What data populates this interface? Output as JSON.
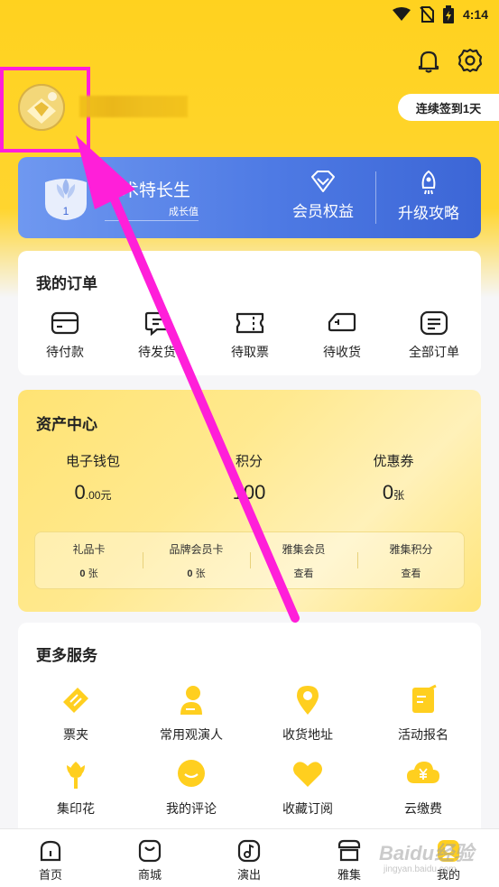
{
  "status_bar": {
    "time": "4:14",
    "icons": [
      "wifi-icon",
      "no-sim-icon",
      "battery-charging-icon"
    ]
  },
  "header": {
    "icons": [
      "bell-icon",
      "gear-icon"
    ],
    "signin_label": "连续签到1天"
  },
  "member": {
    "level_number": "1",
    "title": "艺术特长生",
    "growth_label": "成长值",
    "actions": [
      {
        "label": "会员权益",
        "icon": "diamond-icon"
      },
      {
        "label": "升级攻略",
        "icon": "rocket-icon"
      }
    ]
  },
  "orders": {
    "title": "我的订单",
    "items": [
      {
        "label": "待付款",
        "icon": "wallet-icon"
      },
      {
        "label": "待发货",
        "icon": "package-icon"
      },
      {
        "label": "待取票",
        "icon": "ticket-icon"
      },
      {
        "label": "待收货",
        "icon": "truck-icon"
      },
      {
        "label": "全部订单",
        "icon": "list-icon"
      }
    ]
  },
  "assets": {
    "title": "资产中心",
    "columns": [
      {
        "label": "电子钱包",
        "value": "0",
        "suffix": ".00元"
      },
      {
        "label": "积分",
        "value": "100",
        "suffix": ""
      },
      {
        "label": "优惠券",
        "value": "0",
        "suffix": "张"
      }
    ],
    "sub_items": [
      {
        "label": "礼品卡",
        "value": "0",
        "suffix": " 张"
      },
      {
        "label": "品牌会员卡",
        "value": "0",
        "suffix": " 张"
      },
      {
        "label": "雅集会员",
        "value": "",
        "suffix": "查看"
      },
      {
        "label": "雅集积分",
        "value": "",
        "suffix": "查看"
      }
    ]
  },
  "services": {
    "title": "更多服务",
    "items": [
      {
        "label": "票夹",
        "icon": "ticket-folder-icon"
      },
      {
        "label": "常用观演人",
        "icon": "person-icon"
      },
      {
        "label": "收货地址",
        "icon": "location-pin-icon"
      },
      {
        "label": "活动报名",
        "icon": "edit-form-icon"
      },
      {
        "label": "集印花",
        "icon": "flower-icon"
      },
      {
        "label": "我的评论",
        "icon": "comment-icon"
      },
      {
        "label": "收藏订阅",
        "icon": "heart-icon"
      },
      {
        "label": "云缴费",
        "icon": "cloud-yuan-icon"
      }
    ]
  },
  "bottom_nav": {
    "items": [
      {
        "label": "首页",
        "icon": "home-icon"
      },
      {
        "label": "商城",
        "icon": "shopping-bag-icon"
      },
      {
        "label": "演出",
        "icon": "music-note-icon"
      },
      {
        "label": "雅集",
        "icon": "gathering-icon"
      },
      {
        "label": "我的",
        "icon": "profile-icon"
      }
    ]
  },
  "watermark": {
    "text": "Baidu经验",
    "sub": "jingyan.baidu.com"
  },
  "colors": {
    "brand_yellow": "#ffd21f",
    "member_blue": "#4e7ae4",
    "annotation_pink": "#ff1fd9"
  }
}
